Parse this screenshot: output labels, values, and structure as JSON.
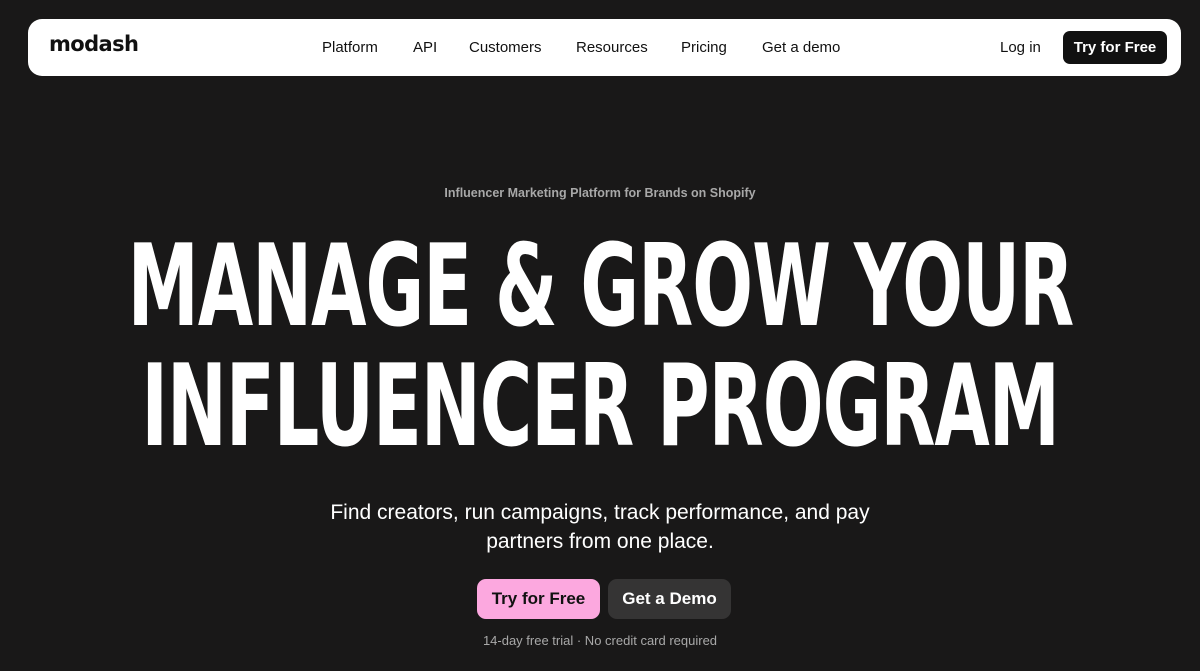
{
  "navbar": {
    "logo": "modash",
    "links": [
      "Platform",
      "API",
      "Customers",
      "Resources",
      "Pricing",
      "Get a demo"
    ],
    "login_label": "Log in",
    "cta_label": "Try for Free"
  },
  "hero": {
    "eyebrow": "Influencer Marketing Platform for Brands on Shopify",
    "headline_lines": [
      "MANAGE & GROW YOUR",
      "INFLUENCER PROGRAM"
    ],
    "subheadline_lines": [
      "Find creators, run campaigns, track performance, and pay",
      "partners from one place."
    ],
    "primary_cta": "Try for Free",
    "secondary_cta": "Get a Demo",
    "trial_note": "14-day free trial · No credit card required"
  },
  "colors": {
    "background": "#191818",
    "nav_background": "#ffffff",
    "primary_button": "#fca8df",
    "secondary_button": "#353434",
    "muted_text": "#a8a8a8"
  }
}
